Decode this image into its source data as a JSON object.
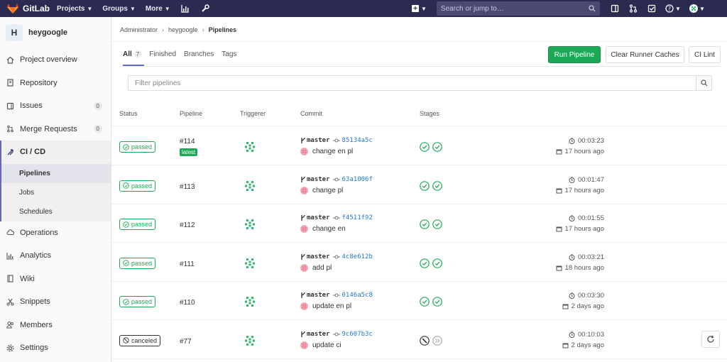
{
  "navbar": {
    "brand": "GitLab",
    "menu": [
      {
        "label": "Projects"
      },
      {
        "label": "Groups"
      },
      {
        "label": "More"
      }
    ],
    "search_placeholder": "Search or jump to…"
  },
  "sidebar": {
    "project_initial": "H",
    "project_name": "heygoogle",
    "items": [
      {
        "label": "Project overview",
        "icon": "home-icon"
      },
      {
        "label": "Repository",
        "icon": "book-icon"
      },
      {
        "label": "Issues",
        "icon": "issues-icon",
        "count": "0"
      },
      {
        "label": "Merge Requests",
        "icon": "merge-request-icon",
        "count": "0"
      },
      {
        "label": "CI / CD",
        "icon": "rocket-icon",
        "active": true
      },
      {
        "label": "Operations",
        "icon": "cloud-icon"
      },
      {
        "label": "Analytics",
        "icon": "chart-icon"
      },
      {
        "label": "Wiki",
        "icon": "wiki-icon"
      },
      {
        "label": "Snippets",
        "icon": "scissors-icon"
      },
      {
        "label": "Members",
        "icon": "users-icon"
      },
      {
        "label": "Settings",
        "icon": "gear-icon"
      }
    ],
    "sub_items": [
      {
        "label": "Pipelines",
        "active": true
      },
      {
        "label": "Jobs"
      },
      {
        "label": "Schedules"
      }
    ]
  },
  "breadcrumb": {
    "items": [
      "Administrator",
      "heygoogle",
      "Pipelines"
    ]
  },
  "tabs": [
    {
      "label": "All",
      "count": "7",
      "active": true
    },
    {
      "label": "Finished"
    },
    {
      "label": "Branches"
    },
    {
      "label": "Tags"
    }
  ],
  "buttons": {
    "run_pipeline": "Run Pipeline",
    "clear_caches": "Clear Runner Caches",
    "ci_lint": "CI Lint"
  },
  "filter_placeholder": "Filter pipelines",
  "table": {
    "headers": [
      "Status",
      "Pipeline",
      "Triggerer",
      "Commit",
      "Stages"
    ],
    "rows": [
      {
        "status": "passed",
        "id": "#114",
        "latest": "latest",
        "branch": "master",
        "sha": "85134a5c",
        "message": "change en pl",
        "stages": [
          "success",
          "success"
        ],
        "duration": "00:03:23",
        "finished": "17 hours ago"
      },
      {
        "status": "passed",
        "id": "#113",
        "branch": "master",
        "sha": "63a1006f",
        "message": "change pl",
        "stages": [
          "success",
          "success"
        ],
        "duration": "00:01:47",
        "finished": "17 hours ago"
      },
      {
        "status": "passed",
        "id": "#112",
        "branch": "master",
        "sha": "f4511f92",
        "message": "change en",
        "stages": [
          "success",
          "success"
        ],
        "duration": "00:01:55",
        "finished": "17 hours ago"
      },
      {
        "status": "passed",
        "id": "#111",
        "branch": "master",
        "sha": "4c8e612b",
        "message": "add pl",
        "stages": [
          "success",
          "success"
        ],
        "duration": "00:03:21",
        "finished": "18 hours ago"
      },
      {
        "status": "passed",
        "id": "#110",
        "branch": "master",
        "sha": "0146a5c8",
        "message": "update en pl",
        "stages": [
          "success",
          "success"
        ],
        "duration": "00:03:30",
        "finished": "2 days ago"
      },
      {
        "status": "canceled",
        "id": "#77",
        "branch": "master",
        "sha": "9c607b3c",
        "message": "update ci",
        "stages": [
          "canceled",
          "skipped"
        ],
        "duration": "00:10:03",
        "finished": "2 days ago"
      }
    ]
  },
  "colors": {
    "navbar": "#2b2b52",
    "success": "#1aaa55",
    "link": "#1f78d1",
    "accent": "#6666c4"
  }
}
